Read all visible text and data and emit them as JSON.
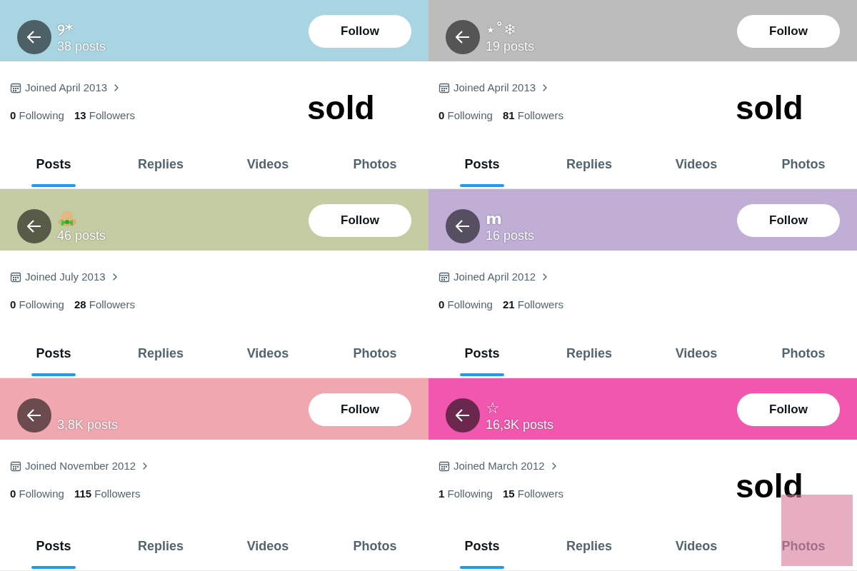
{
  "profiles": [
    {
      "color": "#a9d5e3",
      "name": {
        "kind": "text",
        "text": "୨*"
      },
      "posts": "38 posts",
      "follow": "Follow",
      "joined": "Joined April 2013",
      "following": "0",
      "following_label": "Following",
      "followers": "13",
      "followers_label": "Followers",
      "stamp": "sold",
      "covered": false,
      "tabs": [
        {
          "label": "Posts",
          "selected": true
        },
        {
          "label": "Replies",
          "selected": false
        },
        {
          "label": "Videos",
          "selected": false
        },
        {
          "label": "Photos",
          "selected": false
        }
      ]
    },
    {
      "color": "#bcbcbc",
      "name": {
        "kind": "text",
        "text": "⋆˚❄"
      },
      "posts": "19 posts",
      "follow": "Follow",
      "joined": "Joined April 2013",
      "following": "0",
      "following_label": "Following",
      "followers": "81",
      "followers_label": "Followers",
      "stamp": "sold",
      "covered": false,
      "tabs": [
        {
          "label": "Posts",
          "selected": true
        },
        {
          "label": "Replies",
          "selected": false
        },
        {
          "label": "Videos",
          "selected": false
        },
        {
          "label": "Photos",
          "selected": false
        }
      ]
    },
    {
      "color": "#c5cba3",
      "name": {
        "kind": "emoji"
      },
      "posts": "46 posts",
      "follow": "Follow",
      "joined": "Joined July 2013",
      "following": "0",
      "following_label": "Following",
      "followers": "28",
      "followers_label": "Followers",
      "covered": false,
      "tabs": [
        {
          "label": "Posts",
          "selected": true
        },
        {
          "label": "Replies",
          "selected": false
        },
        {
          "label": "Videos",
          "selected": false
        },
        {
          "label": "Photos",
          "selected": false
        }
      ]
    },
    {
      "color": "#c0aed7",
      "name": {
        "kind": "text",
        "text": "m"
      },
      "posts": "16 posts",
      "follow": "Follow",
      "joined": "Joined April 2012",
      "following": "0",
      "following_label": "Following",
      "followers": "21",
      "followers_label": "Followers",
      "covered": false,
      "tabs": [
        {
          "label": "Posts",
          "selected": true
        },
        {
          "label": "Replies",
          "selected": false
        },
        {
          "label": "Videos",
          "selected": false
        },
        {
          "label": "Photos",
          "selected": false
        }
      ]
    },
    {
      "color": "#f0a7b0",
      "posts": "3,8K posts",
      "follow": "Follow",
      "joined": "Joined November 2012",
      "following": "0",
      "following_label": "Following",
      "followers": "115",
      "followers_label": "Followers",
      "covered": false,
      "tabs": [
        {
          "label": "Posts",
          "selected": true
        },
        {
          "label": "Replies",
          "selected": false
        },
        {
          "label": "Videos",
          "selected": false
        },
        {
          "label": "Photos",
          "selected": false
        }
      ]
    },
    {
      "color": "#f157ae",
      "name": {
        "kind": "text",
        "text": "☆"
      },
      "posts": "16,3K posts",
      "follow": "Follow",
      "joined": "Joined March 2012",
      "following": "1",
      "following_label": "Following",
      "followers": "15",
      "followers_label": "Followers",
      "stamp": "sold",
      "covered": true,
      "tabs": [
        {
          "label": "Posts",
          "selected": true
        },
        {
          "label": "Replies",
          "selected": false
        },
        {
          "label": "Videos",
          "selected": false
        },
        {
          "label": "Photos",
          "selected": false
        }
      ]
    }
  ]
}
